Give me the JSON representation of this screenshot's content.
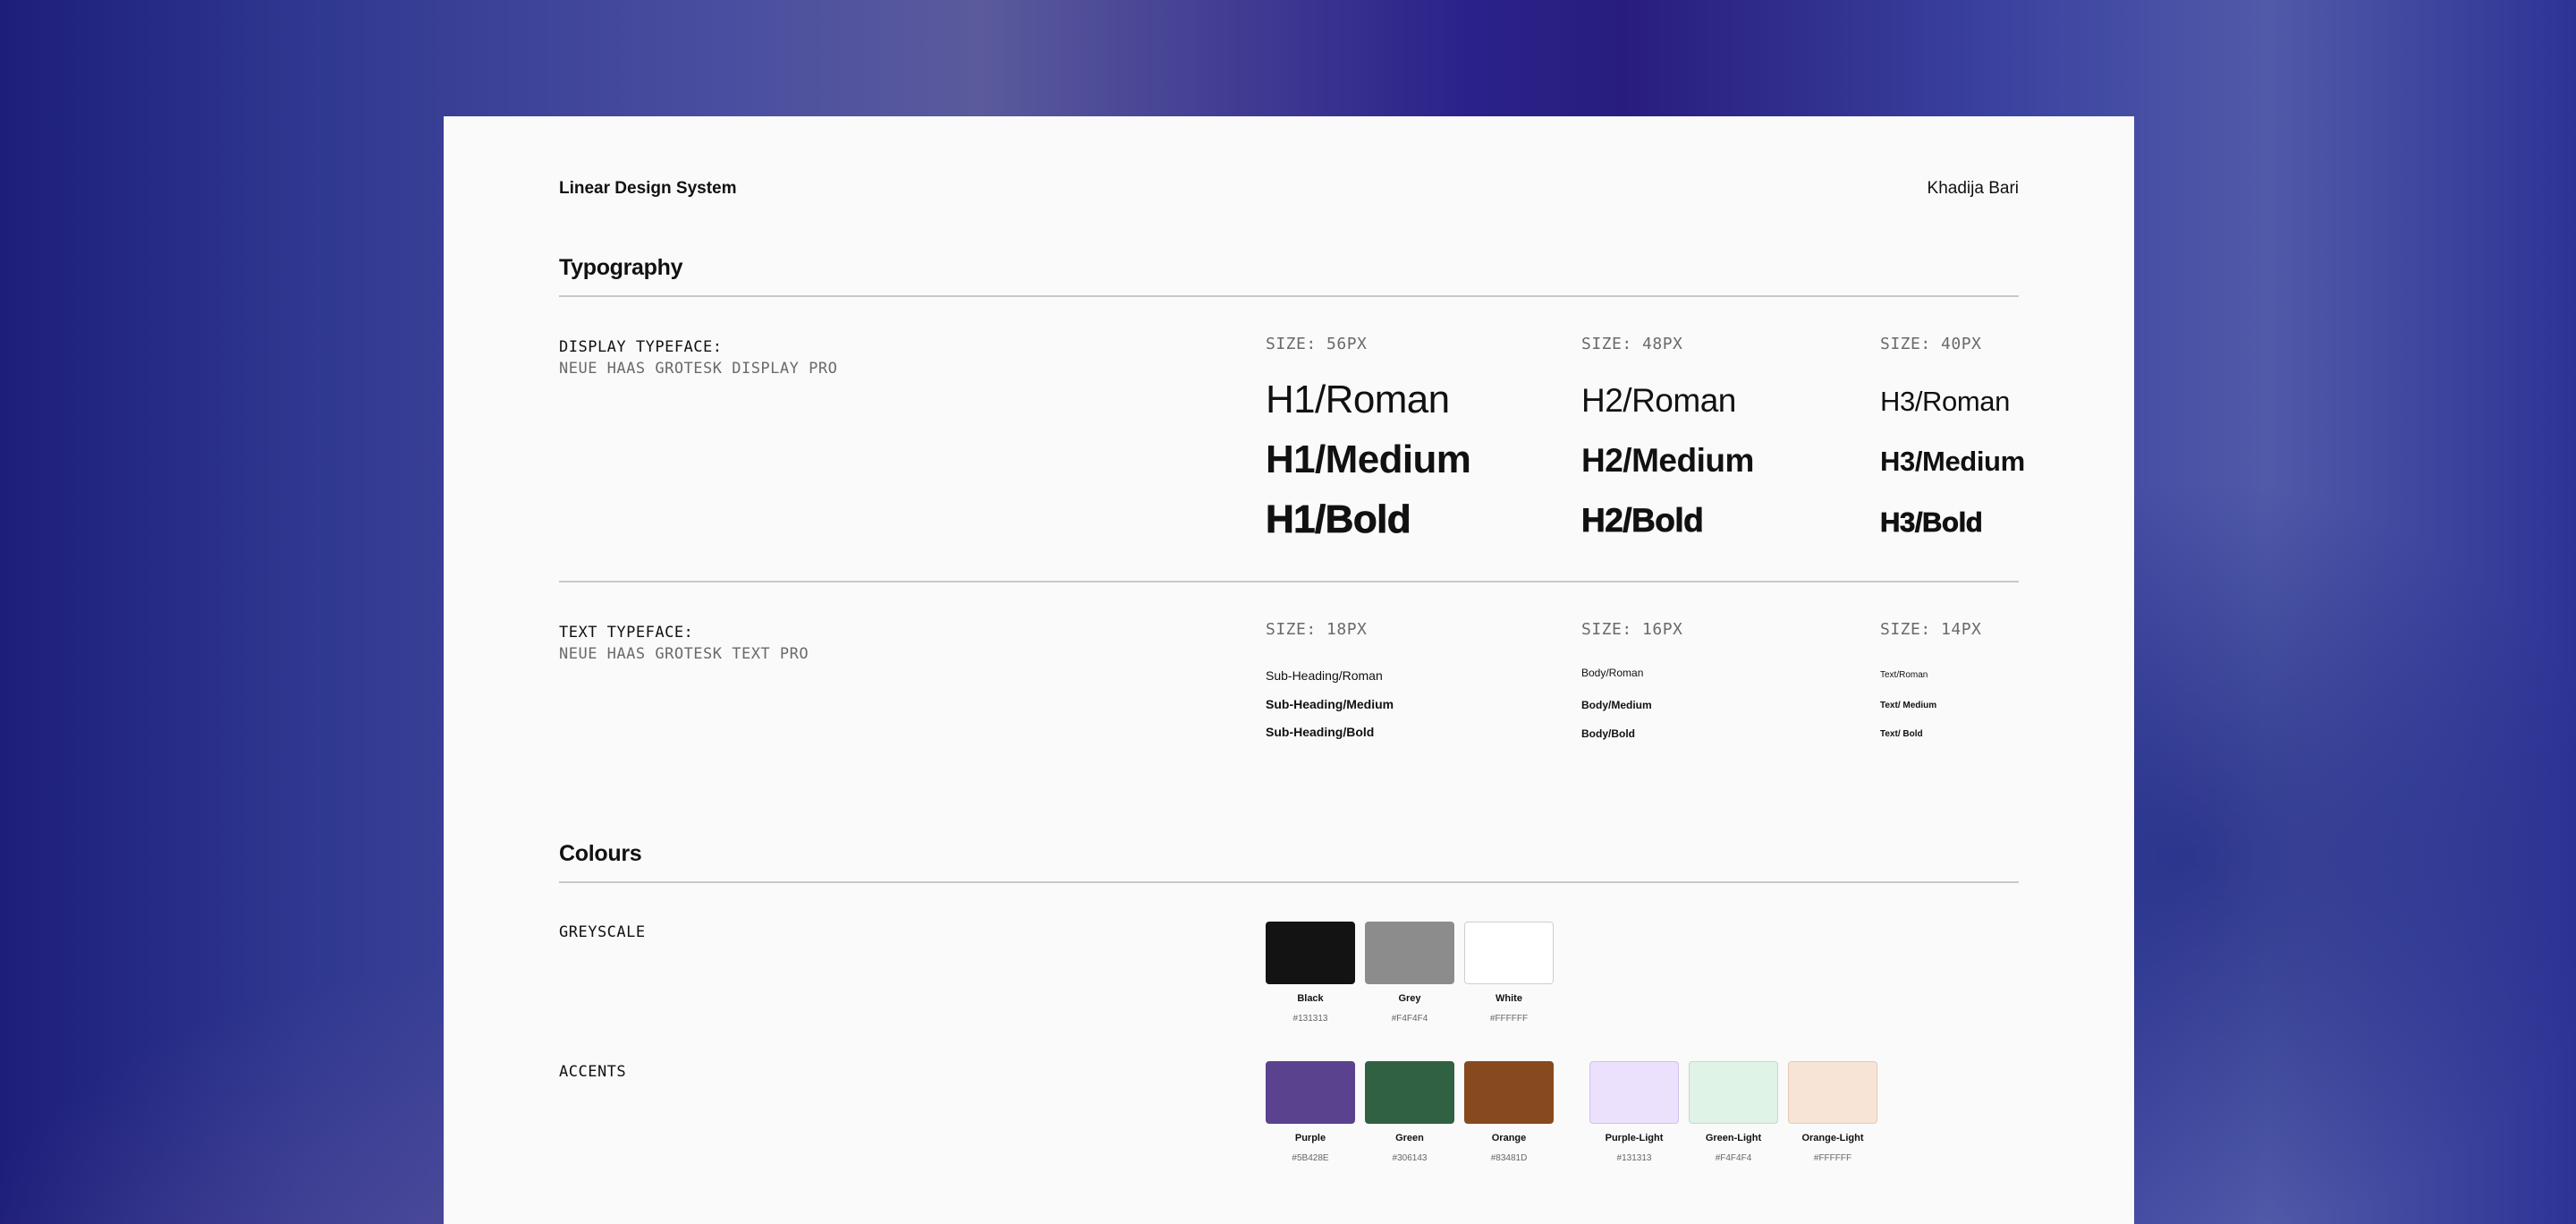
{
  "header": {
    "brand": "Linear Design System",
    "author": "Khadija Bari"
  },
  "typography": {
    "title": "Typography",
    "display": {
      "label": "DISPLAY TYPEFACE:",
      "typeface": "NEUE HAAS GROTESK DISPLAY PRO",
      "columns": [
        {
          "size": "SIZE: 56PX",
          "roman": "H1/Roman",
          "medium": "H1/Medium",
          "bold": "H1/Bold"
        },
        {
          "size": "SIZE: 48PX",
          "roman": "H2/Roman",
          "medium": "H2/Medium",
          "bold": "H2/Bold"
        },
        {
          "size": "SIZE: 40PX",
          "roman": "H3/Roman",
          "medium": "H3/Medium",
          "bold": "H3/Bold"
        }
      ]
    },
    "text": {
      "label": "TEXT TYPEFACE:",
      "typeface": "NEUE HAAS GROTESK TEXT PRO",
      "columns": [
        {
          "size": "SIZE: 18PX",
          "roman": "Sub-Heading/Roman",
          "medium": "Sub-Heading/Medium",
          "bold": "Sub-Heading/Bold"
        },
        {
          "size": "SIZE: 16PX",
          "roman": "Body/Roman",
          "medium": "Body/Medium",
          "bold": "Body/Bold"
        },
        {
          "size": "SIZE: 14PX",
          "roman": "Text/Roman",
          "medium": "Text/ Medium",
          "bold": "Text/ Bold"
        }
      ]
    }
  },
  "colours": {
    "title": "Colours",
    "greyscale": {
      "label": "GREYSCALE",
      "swatches": [
        {
          "name": "Black",
          "hex": "#131313",
          "color": "#131313",
          "border": "#131313"
        },
        {
          "name": "Grey",
          "hex": "#F4F4F4",
          "color": "#8c8c8c",
          "border": "#8c8c8c"
        },
        {
          "name": "White",
          "hex": "#FFFFFF",
          "color": "#ffffff",
          "border": "#cfcfcf"
        }
      ]
    },
    "accents": {
      "label": "ACCENTS",
      "swatches": [
        {
          "name": "Purple",
          "hex": "#5B428E",
          "color": "#5b428e",
          "border": "#5b428e"
        },
        {
          "name": "Green",
          "hex": "#306143",
          "color": "#306143",
          "border": "#306143"
        },
        {
          "name": "Orange",
          "hex": "#83481D",
          "color": "#874a1f",
          "border": "#874a1f"
        },
        {
          "name": "Purple-Light",
          "hex": "#131313",
          "color": "#ebe1fd",
          "border": "#cfc3ea"
        },
        {
          "name": "Green-Light",
          "hex": "#F4F4F4",
          "color": "#dff3e6",
          "border": "#c2dcca"
        },
        {
          "name": "Orange-Light",
          "hex": "#FFFFFF",
          "color": "#f7e4d6",
          "border": "#e3cbb8"
        }
      ]
    }
  }
}
